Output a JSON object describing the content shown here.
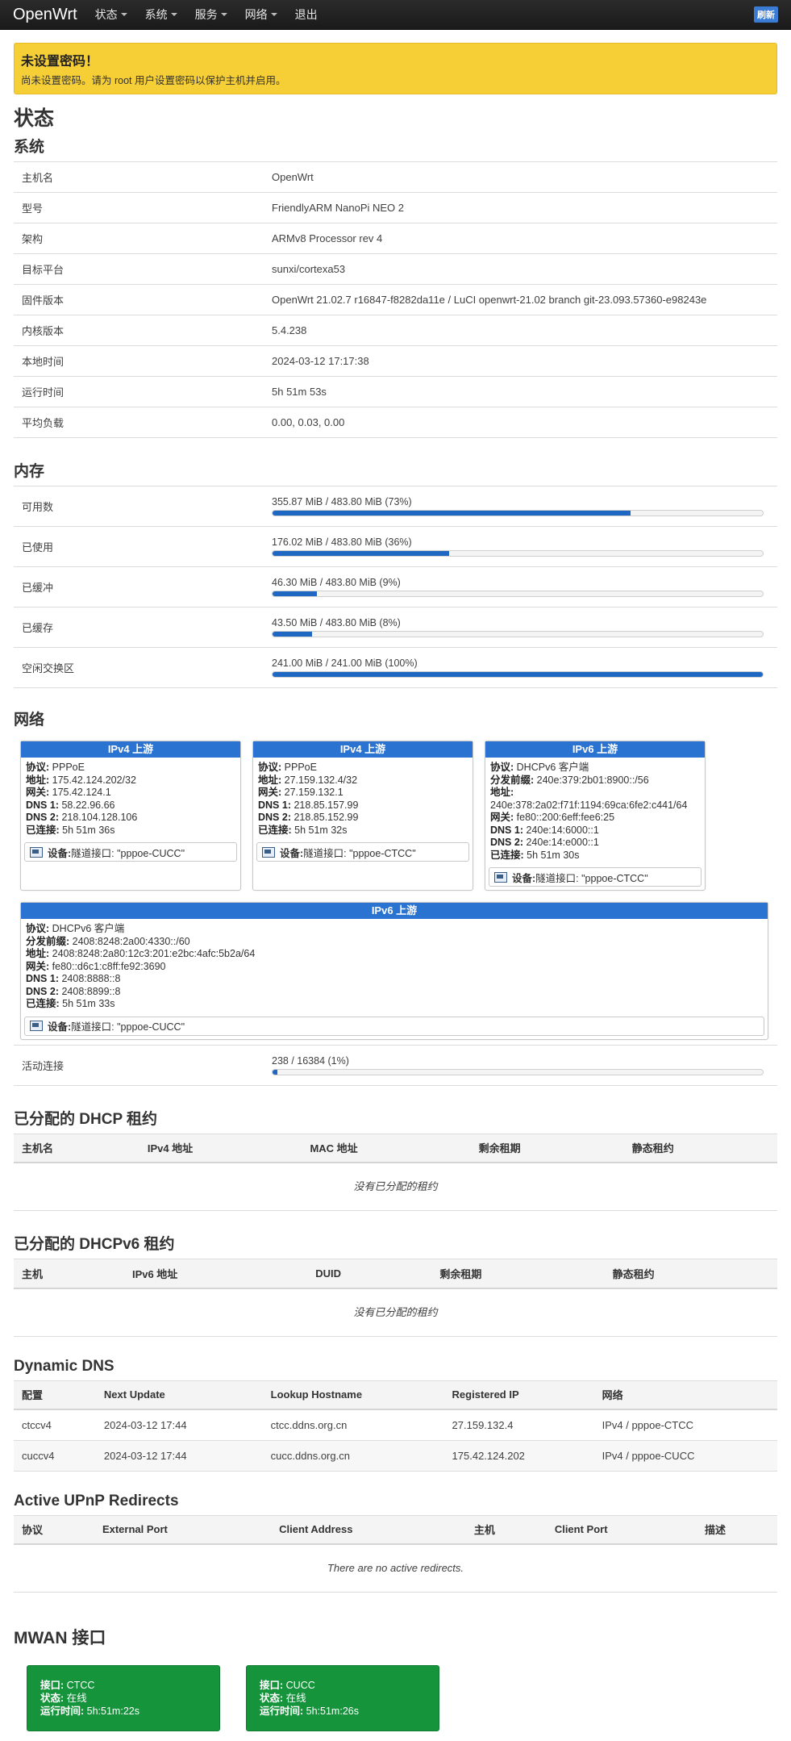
{
  "nav": {
    "brand": "OpenWrt",
    "menu": [
      "状态",
      "系统",
      "服务",
      "网络"
    ],
    "logout": "退出",
    "refresh": "刷新"
  },
  "alert": {
    "title": "未设置密码！",
    "text": "尚未设置密码。请为 root 用户设置密码以保护主机并启用。"
  },
  "page_title": "状态",
  "system": {
    "title": "系统",
    "rows": [
      {
        "k": "主机名",
        "v": "OpenWrt"
      },
      {
        "k": "型号",
        "v": "FriendlyARM NanoPi NEO 2"
      },
      {
        "k": "架构",
        "v": "ARMv8 Processor rev 4"
      },
      {
        "k": "目标平台",
        "v": "sunxi/cortexa53"
      },
      {
        "k": "固件版本",
        "v": "OpenWrt 21.02.7 r16847-f8282da11e / LuCI openwrt-21.02 branch git-23.093.57360-e98243e"
      },
      {
        "k": "内核版本",
        "v": "5.4.238"
      },
      {
        "k": "本地时间",
        "v": "2024-03-12 17:17:38"
      },
      {
        "k": "运行时间",
        "v": "5h 51m 53s"
      },
      {
        "k": "平均负载",
        "v": "0.00, 0.03, 0.00"
      }
    ]
  },
  "memory": {
    "title": "内存",
    "rows": [
      {
        "k": "可用数",
        "v": "355.87 MiB / 483.80 MiB (73%)",
        "pct": 73
      },
      {
        "k": "已使用",
        "v": "176.02 MiB / 483.80 MiB (36%)",
        "pct": 36
      },
      {
        "k": "已缓冲",
        "v": "46.30 MiB / 483.80 MiB (9%)",
        "pct": 9
      },
      {
        "k": "已缓存",
        "v": "43.50 MiB / 483.80 MiB (8%)",
        "pct": 8
      },
      {
        "k": "空闲交换区",
        "v": "241.00 MiB / 241.00 MiB (100%)",
        "pct": 100
      }
    ]
  },
  "network": {
    "title": "网络",
    "cards": [
      {
        "head": "IPv4 上游",
        "lines": [
          [
            "协议:",
            "PPPoE"
          ],
          [
            "地址:",
            "175.42.124.202/32"
          ],
          [
            "网关:",
            "175.42.124.1"
          ],
          [
            "DNS 1:",
            "58.22.96.66"
          ],
          [
            "DNS 2:",
            "218.104.128.106"
          ],
          [
            "已连接:",
            "5h 51m 36s"
          ]
        ],
        "device_label": "设备:",
        "device": "隧道接口: \"pppoe-CUCC\""
      },
      {
        "head": "IPv4 上游",
        "lines": [
          [
            "协议:",
            "PPPoE"
          ],
          [
            "地址:",
            "27.159.132.4/32"
          ],
          [
            "网关:",
            "27.159.132.1"
          ],
          [
            "DNS 1:",
            "218.85.157.99"
          ],
          [
            "DNS 2:",
            "218.85.152.99"
          ],
          [
            "已连接:",
            "5h 51m 32s"
          ]
        ],
        "device_label": "设备:",
        "device": "隧道接口: \"pppoe-CTCC\""
      },
      {
        "head": "IPv6 上游",
        "lines": [
          [
            "协议:",
            "DHCPv6 客户端"
          ],
          [
            "分发前缀:",
            "240e:379:2b01:8900::/56"
          ],
          [
            "地址:",
            "240e:378:2a02:f71f:1194:69ca:6fe2:c441/64"
          ],
          [
            "网关:",
            "fe80::200:6eff:fee6:25"
          ],
          [
            "DNS 1:",
            "240e:14:6000::1"
          ],
          [
            "DNS 2:",
            "240e:14:e000::1"
          ],
          [
            "已连接:",
            "5h 51m 30s"
          ]
        ],
        "device_label": "设备:",
        "device": "隧道接口: \"pppoe-CTCC\""
      },
      {
        "head": "IPv6 上游",
        "lines": [
          [
            "协议:",
            "DHCPv6 客户端"
          ],
          [
            "分发前缀:",
            "2408:8248:2a00:4330::/60"
          ],
          [
            "地址:",
            "2408:8248:2a80:12c3:201:e2bc:4afc:5b2a/64"
          ],
          [
            "网关:",
            "fe80::d6c1:c8ff:fe92:3690"
          ],
          [
            "DNS 1:",
            "2408:8888::8"
          ],
          [
            "DNS 2:",
            "2408:8899::8"
          ],
          [
            "已连接:",
            "5h 51m 33s"
          ]
        ],
        "device_label": "设备:",
        "device": "隧道接口: \"pppoe-CUCC\""
      }
    ],
    "conn_label": "活动连接",
    "conn_value": "238 / 16384 (1%)",
    "conn_pct": 1
  },
  "dhcp": {
    "title": "已分配的 DHCP 租约",
    "cols": [
      "主机名",
      "IPv4 地址",
      "MAC 地址",
      "剩余租期",
      "静态租约"
    ],
    "empty": "没有已分配的租约"
  },
  "dhcp6": {
    "title": "已分配的 DHCPv6 租约",
    "cols": [
      "主机",
      "IPv6 地址",
      "DUID",
      "剩余租期",
      "静态租约"
    ],
    "empty": "没有已分配的租约"
  },
  "ddns": {
    "title": "Dynamic DNS",
    "cols": [
      "配置",
      "Next Update",
      "Lookup Hostname",
      "Registered IP",
      "网络"
    ],
    "rows": [
      [
        "ctccv4",
        "2024-03-12 17:44",
        "ctcc.ddns.org.cn",
        "27.159.132.4",
        "IPv4 / pppoe-CTCC"
      ],
      [
        "cuccv4",
        "2024-03-12 17:44",
        "cucc.ddns.org.cn",
        "175.42.124.202",
        "IPv4 / pppoe-CUCC"
      ]
    ]
  },
  "upnp": {
    "title": "Active UPnP Redirects",
    "cols": [
      "协议",
      "External Port",
      "Client Address",
      "主机",
      "Client Port",
      "描述"
    ],
    "empty": "There are no active redirects."
  },
  "mwan": {
    "title": "MWAN 接口",
    "cards": [
      {
        "iface_label": "接口:",
        "iface": "CTCC",
        "status_label": "状态:",
        "status": "在线",
        "uptime_label": "运行时间:",
        "uptime": "5h:51m:22s"
      },
      {
        "iface_label": "接口:",
        "iface": "CUCC",
        "status_label": "状态:",
        "status": "在线",
        "uptime_label": "运行时间:",
        "uptime": "5h:51m:26s"
      }
    ]
  }
}
